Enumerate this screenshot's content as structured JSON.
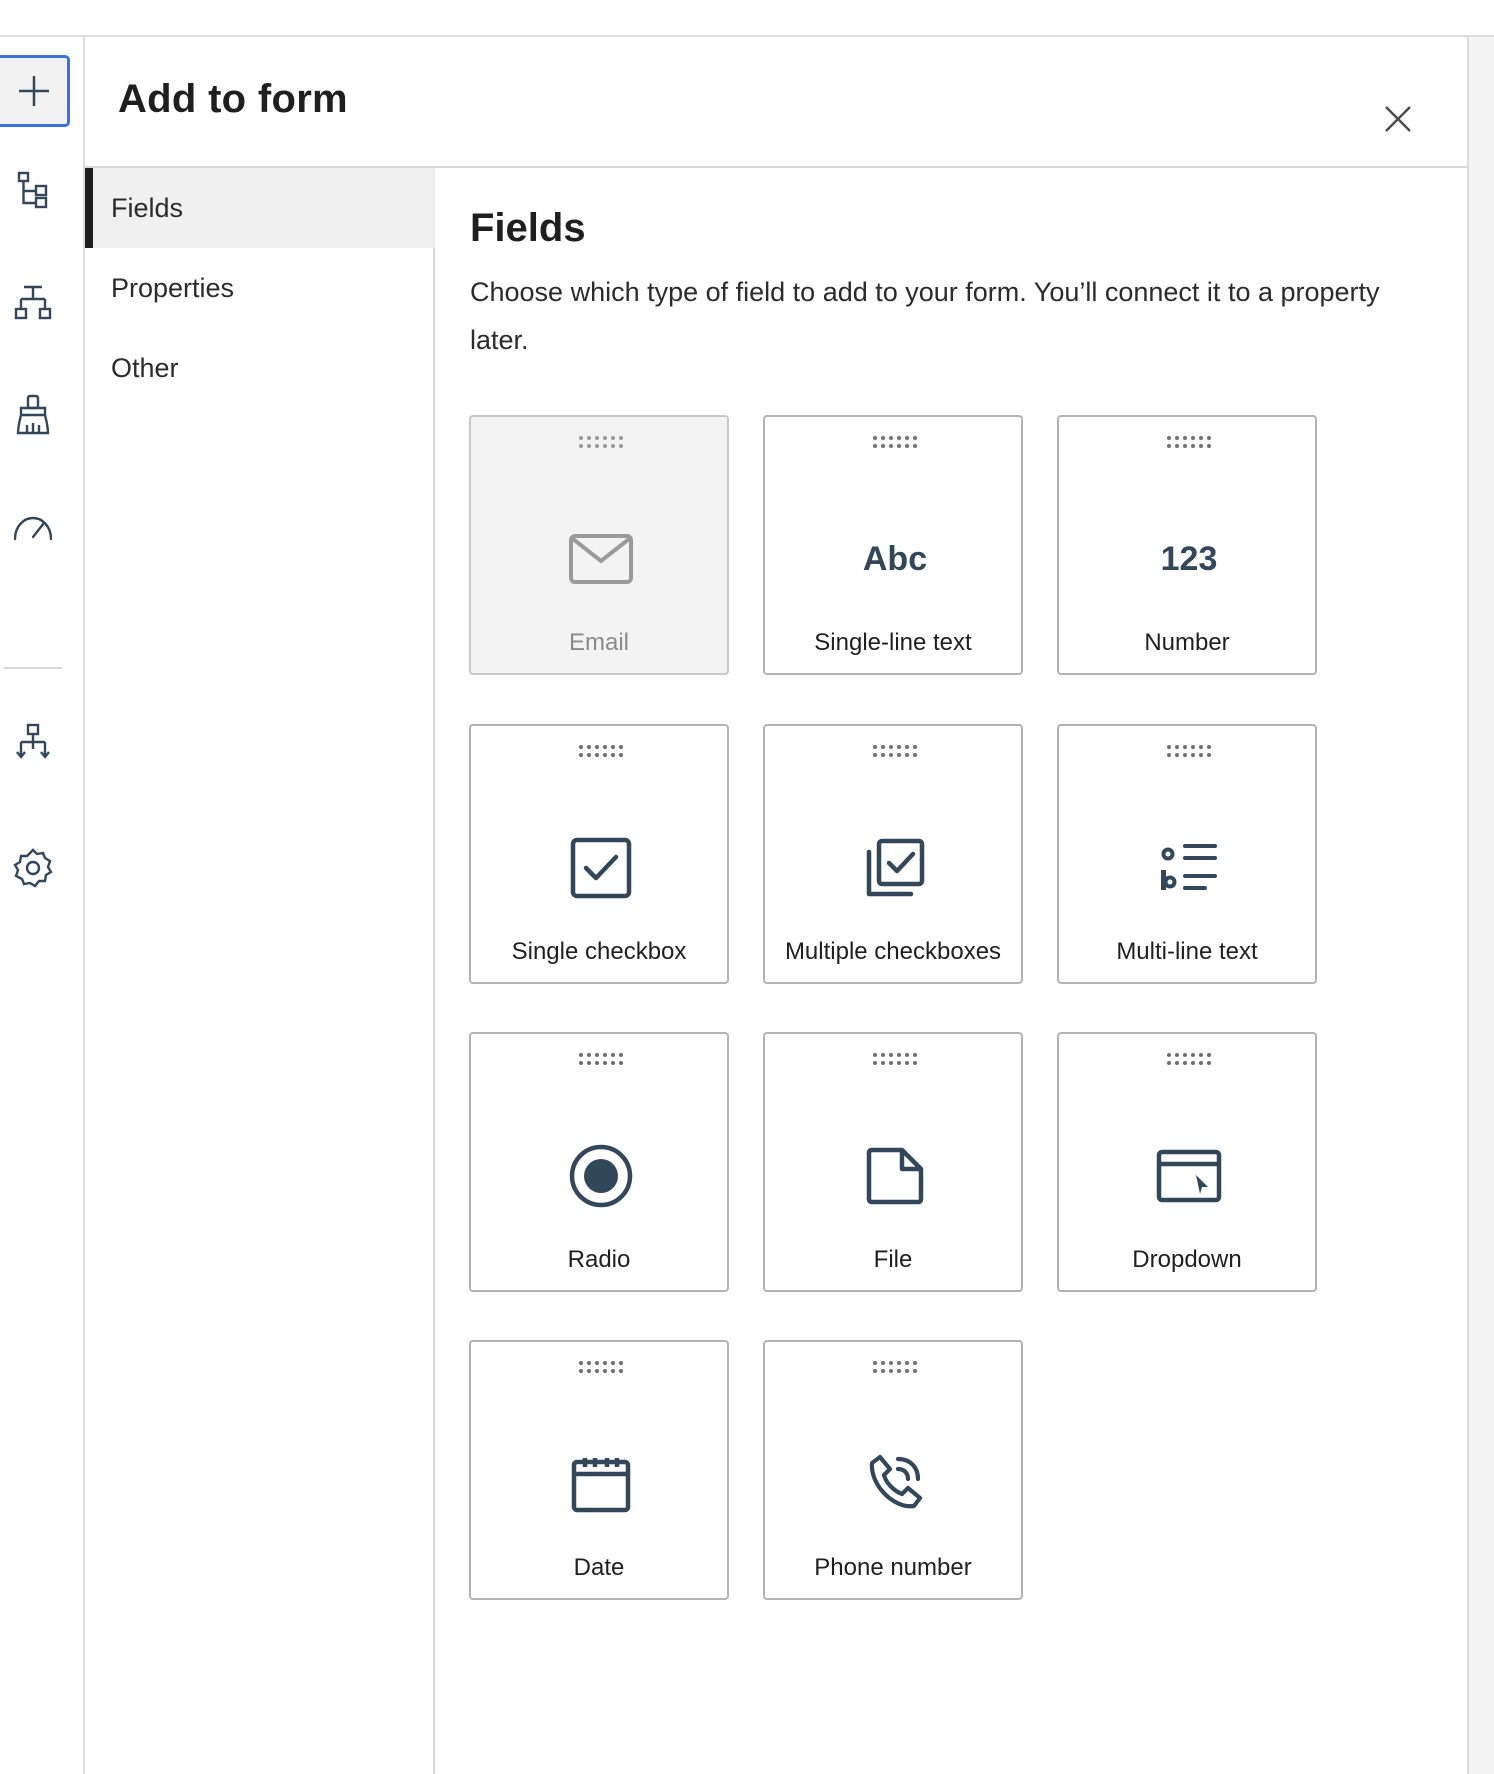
{
  "panel": {
    "title": "Add to form",
    "close_label": "close"
  },
  "rail": {
    "icons": [
      "plus-icon",
      "tree-icon",
      "hierarchy-icon",
      "paint-brush-icon",
      "speedometer-icon",
      "workflow-icon",
      "settings-icon"
    ]
  },
  "subnav": {
    "items": [
      {
        "label": "Fields",
        "active": true
      },
      {
        "label": "Properties",
        "active": false
      },
      {
        "label": "Other",
        "active": false
      }
    ]
  },
  "content": {
    "title": "Fields",
    "description": "Choose which type of field to add to your form. You’ll connect it to a property later.",
    "fields": [
      {
        "label": "Email",
        "icon": "email-icon",
        "disabled": true
      },
      {
        "label": "Single-line text",
        "icon": "abc-icon",
        "glyph": "Abc",
        "disabled": false
      },
      {
        "label": "Number",
        "icon": "number-icon",
        "glyph": "123",
        "disabled": false
      },
      {
        "label": "Single checkbox",
        "icon": "checkbox-icon",
        "disabled": false
      },
      {
        "label": "Multiple checkboxes",
        "icon": "multiple-checkboxes-icon",
        "disabled": false
      },
      {
        "label": "Multi-line text",
        "icon": "multiline-text-icon",
        "disabled": false
      },
      {
        "label": "Radio",
        "icon": "radio-icon",
        "disabled": false
      },
      {
        "label": "File",
        "icon": "file-icon",
        "disabled": false
      },
      {
        "label": "Dropdown",
        "icon": "dropdown-icon",
        "disabled": false
      },
      {
        "label": "Date",
        "icon": "calendar-icon",
        "disabled": false
      },
      {
        "label": "Phone number",
        "icon": "phone-icon",
        "disabled": false
      }
    ]
  },
  "colors": {
    "accent": "#3b74d6",
    "icon": "#33475b",
    "border": "#b3b3b3",
    "active_bg": "#f0f0f0"
  }
}
